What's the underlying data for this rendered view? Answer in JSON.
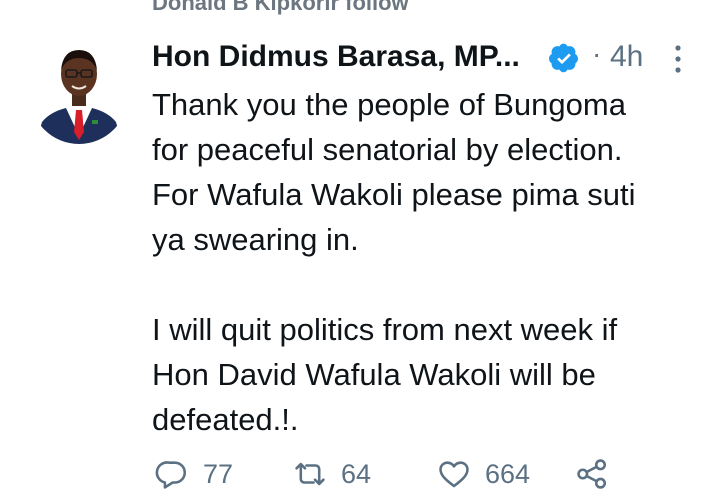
{
  "social_context": "Donald B Kipkorir follow",
  "tweet": {
    "author_name": "Hon Didmus Barasa, MP...",
    "timestamp": "4h",
    "separator": "·",
    "text": "Thank you the people of Bungoma\nfor peaceful senatorial by election.\nFor Wafula Wakoli please pima suti\nya swearing in.\n\nI will quit politics from next week if\nHon David Wafula Wakoli will be\ndefeated.!."
  },
  "actions": {
    "replies": "77",
    "retweets": "64",
    "likes": "664"
  },
  "icons": {
    "verified": "verified-badge-icon",
    "more": "more-options-icon",
    "reply": "reply-icon",
    "retweet": "retweet-icon",
    "like": "heart-icon",
    "share": "share-icon"
  },
  "colors": {
    "verified_blue": "#1d9bf0",
    "secondary_text": "#5b7083",
    "primary_text": "#0f1419"
  }
}
